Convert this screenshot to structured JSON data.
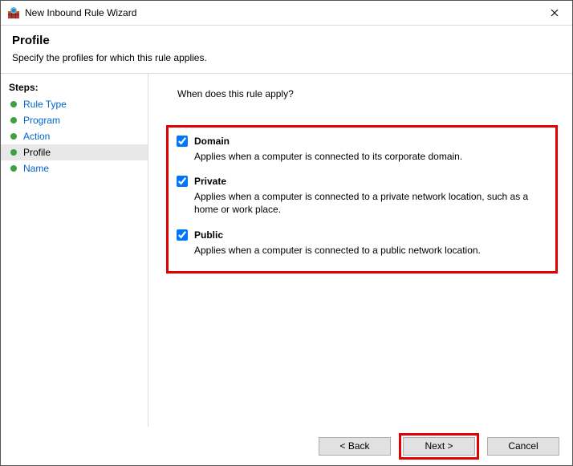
{
  "window": {
    "title": "New Inbound Rule Wizard"
  },
  "header": {
    "title": "Profile",
    "description": "Specify the profiles for which this rule applies."
  },
  "sidebar": {
    "title": "Steps:",
    "items": [
      {
        "label": "Rule Type",
        "active": false
      },
      {
        "label": "Program",
        "active": false
      },
      {
        "label": "Action",
        "active": false
      },
      {
        "label": "Profile",
        "active": true
      },
      {
        "label": "Name",
        "active": false
      }
    ]
  },
  "content": {
    "question": "When does this rule apply?",
    "options": [
      {
        "label": "Domain",
        "checked": true,
        "description": "Applies when a computer is connected to its corporate domain."
      },
      {
        "label": "Private",
        "checked": true,
        "description": "Applies when a computer is connected to a private network location, such as a home or work place."
      },
      {
        "label": "Public",
        "checked": true,
        "description": "Applies when a computer is connected to a public network location."
      }
    ]
  },
  "footer": {
    "back": "< Back",
    "next": "Next >",
    "cancel": "Cancel"
  }
}
